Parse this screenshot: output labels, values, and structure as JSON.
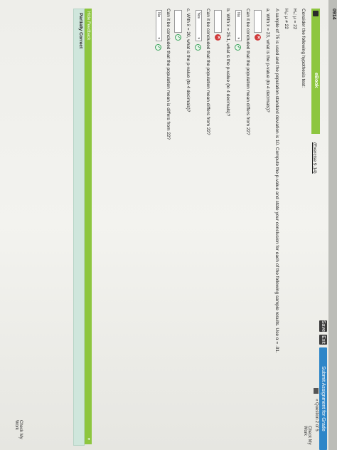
{
  "bezel": {
    "label": "0914"
  },
  "toolbar": {
    "save": "Save",
    "exit": "Exit",
    "submit": "Submit Assignment for Grade",
    "question_nav": "« Question 2 of 5",
    "check_my_work": "Check My Work"
  },
  "ebook": {
    "label": "eBook",
    "exercise": "(Exercise 9.14)"
  },
  "question": {
    "intro": "Consider the following hypothesis test:",
    "h0": "H₀: μ = 22",
    "ha": "Hₐ: μ ≠ 22",
    "setup": "A sample of 75 is used and the population standard deviation is 10. Compute the p-value and state your conclusion for each of the following sample results. Use α = .01.",
    "a": {
      "prompt": "a. With x̄ = 23, what is the p-value (to 4 decimals)?",
      "followup": "Can it be concluded that the population mean differs from 22?",
      "answer": "No"
    },
    "b": {
      "prompt": "b. With x̄ = 25.1, what is the p-value (to 4 decimals)?",
      "followup": "Can it be concluded that the population mean differs from 22?",
      "answer": "Yes"
    },
    "c": {
      "prompt": "c. With x̄ = 20, what is the p-value (to 4 decimals)?",
      "followup": "Can it be concluded that the population mean is differs from 22?",
      "answer": "No"
    }
  },
  "feedback": {
    "toggle": "Hide Feedback",
    "status": "Partially Correct"
  },
  "footer": {
    "check_my_work": "Check My Work"
  }
}
